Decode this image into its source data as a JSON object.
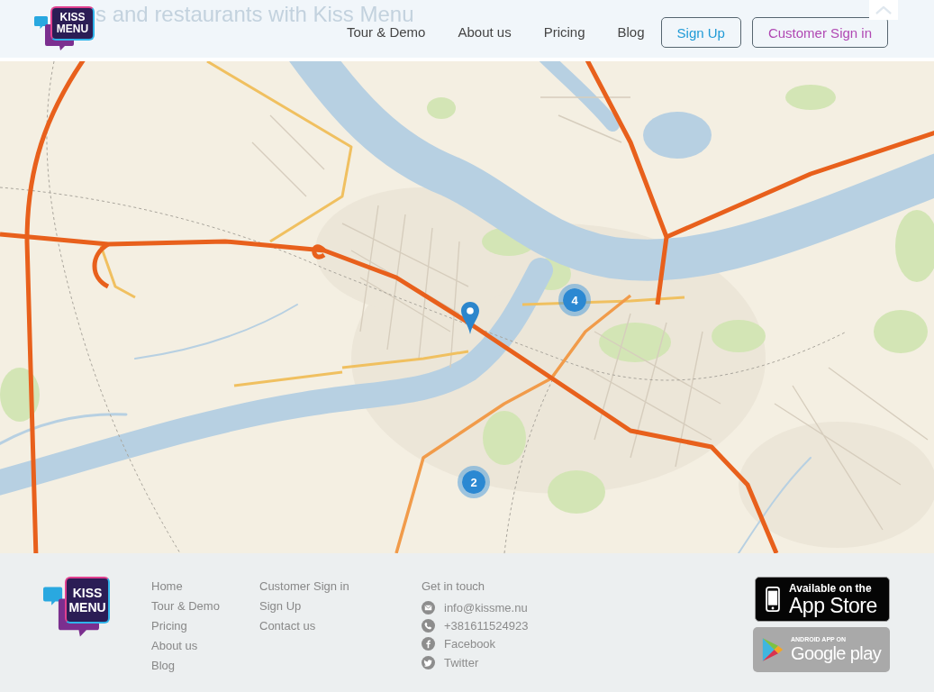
{
  "header": {
    "headline": "s and restaurants with Kiss Menu",
    "logo": [
      "KISS",
      "MENU"
    ],
    "nav": [
      "Tour & Demo",
      "About us",
      "Pricing",
      "Blog"
    ],
    "buttons": [
      {
        "label": "Sign Up",
        "kind": "signup"
      },
      {
        "label": "Customer Sign in",
        "kind": "signin"
      }
    ]
  },
  "map": {
    "markers": [
      {
        "kind": "cluster",
        "count": "4"
      },
      {
        "kind": "cluster",
        "count": "2"
      },
      {
        "kind": "pin"
      }
    ]
  },
  "footer": {
    "logo": [
      "KISS",
      "MENU"
    ],
    "links_1": [
      "Home",
      "Tour & Demo",
      "Pricing",
      "About us",
      "Blog"
    ],
    "links_2": [
      "Customer Sign in",
      "Sign Up",
      "Contact us"
    ],
    "contact": {
      "title": "Get in touch",
      "items": [
        {
          "kind": "email",
          "text": "info@kissme.nu"
        },
        {
          "kind": "phone",
          "text": "+381611524923"
        },
        {
          "kind": "facebook",
          "text": "Facebook"
        },
        {
          "kind": "twitter",
          "text": "Twitter"
        }
      ]
    },
    "badges": [
      {
        "kind": "app_store",
        "line_1": "Available on the",
        "line_2": "App Store"
      },
      {
        "kind": "google_play",
        "line_1": "ANDROID APP ON",
        "line_2": "Google play"
      }
    ]
  }
}
